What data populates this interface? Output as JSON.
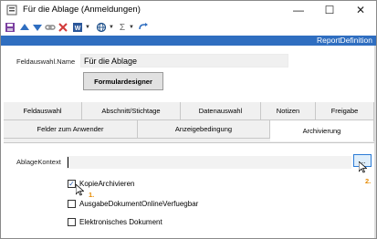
{
  "window": {
    "title": "Für die Ablage (Anmeldungen)",
    "minimize": "—",
    "maximize": "☐",
    "close": "✕"
  },
  "toolbar": {
    "icons": [
      "save-icon",
      "arrow-up-icon",
      "arrow-down-icon",
      "link-icon",
      "delete-icon",
      "word-icon",
      "globe-icon",
      "sigma-icon",
      "redo-icon"
    ],
    "sigma": "Σ"
  },
  "header": {
    "report_definition": "ReportDefinition"
  },
  "form": {
    "name_label": "Feldauswahl.Name",
    "name_value": "Für die Ablage",
    "designer_button": "Formulardesigner"
  },
  "tabs": {
    "row1": [
      "Feldauswahl",
      "Abschnitt/Stichtage",
      "Datenauswahl",
      "Notizen",
      "Freigabe"
    ],
    "row2": [
      "Felder zum Anwender",
      "Anzeigebedingung",
      "Archivierung"
    ],
    "active": "Archivierung"
  },
  "archiv": {
    "kontext_label": "AblageKontext",
    "kontext_value": "",
    "browse_button": "...",
    "annotation_1": "1.",
    "annotation_2": "2.",
    "checkboxes": [
      {
        "label": "KopieArchivieren",
        "checked": true
      },
      {
        "label": "AusgabeDokumentOnlineVerfuegbar",
        "checked": false
      },
      {
        "label": "Elektronisches Dokument",
        "checked": false
      }
    ],
    "accent_blue": "#2f6ec0",
    "annotation_color": "#e68a00"
  }
}
